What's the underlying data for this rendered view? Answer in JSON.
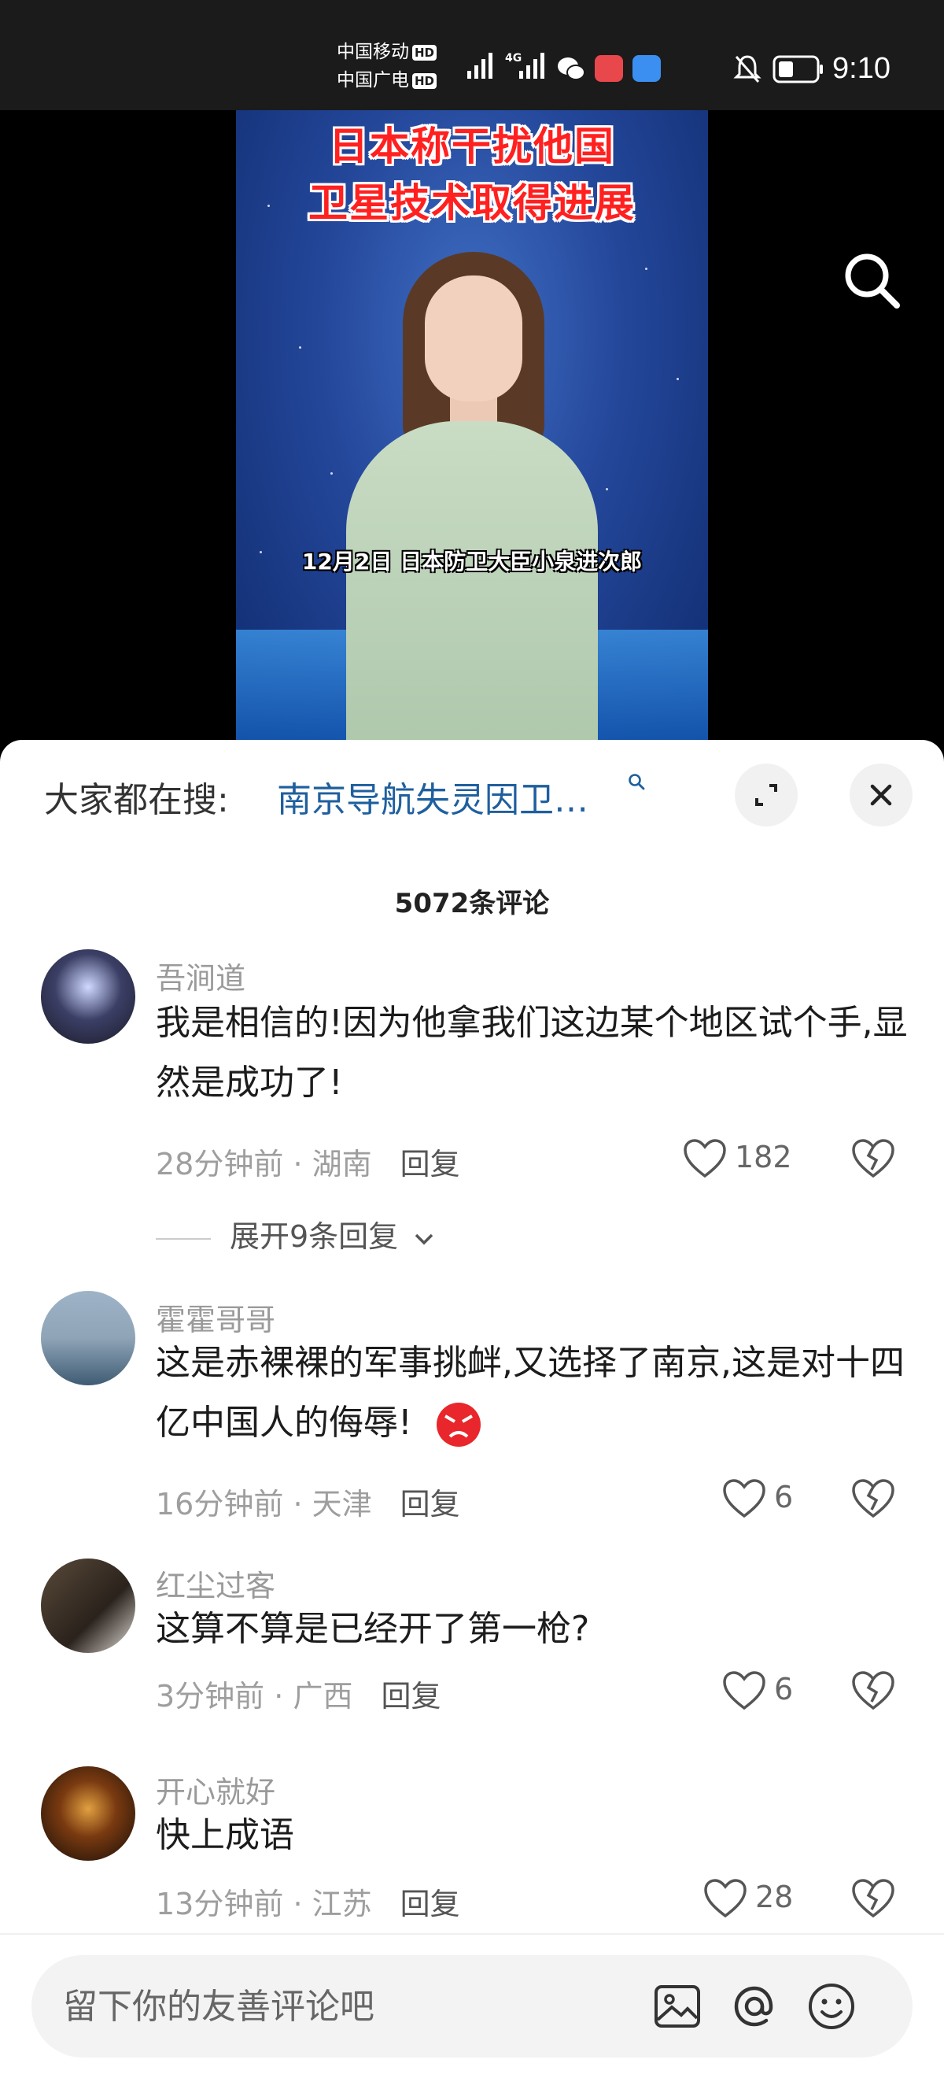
{
  "status_bar": {
    "carrier_1": "中国移动",
    "carrier_2": "中国广电",
    "hd_badge": "HD",
    "network_label": "4G",
    "time": "9:10",
    "icons": [
      "signal-icon",
      "wechat-icon",
      "huawei-app-icon",
      "weather-app-icon",
      "mute-icon",
      "battery-icon"
    ]
  },
  "video": {
    "headline_line1": "日本称干扰他国",
    "headline_line2": "卫星技术取得进展",
    "subtitle": "12月2日 日本防卫大臣小泉进次郎"
  },
  "sheet": {
    "trending_label": "大家都在搜:",
    "trending_query": "南京导航失灵因卫…",
    "comment_count": "5072条评论"
  },
  "comments": [
    {
      "name": "吾涧道",
      "text": "我是相信的!因为他拿我们这边某个地区试个手,显然是成功了!",
      "time": "28分钟前",
      "location": "湖南",
      "reply_label": "回复",
      "likes": "182",
      "expand_label": "展开9条回复"
    },
    {
      "name": "霍霍哥哥",
      "text": "这是赤裸裸的军事挑衅,又选择了南京,这是对十四亿中国人的侮辱!",
      "time": "16分钟前",
      "location": "天津",
      "reply_label": "回复",
      "likes": "6"
    },
    {
      "name": "红尘过客",
      "text": "这算不算是已经开了第一枪?",
      "time": "3分钟前",
      "location": "广西",
      "reply_label": "回复",
      "likes": "6"
    },
    {
      "name": "开心就好",
      "text": "快上成语",
      "time": "13分钟前",
      "location": "江苏",
      "reply_label": "回复",
      "likes": "28"
    }
  ],
  "input": {
    "placeholder": "留下你的友善评论吧"
  },
  "colors": {
    "link": "#1f5f9e",
    "headline": "#ff2020",
    "angry_emoji": "#e8262b"
  }
}
